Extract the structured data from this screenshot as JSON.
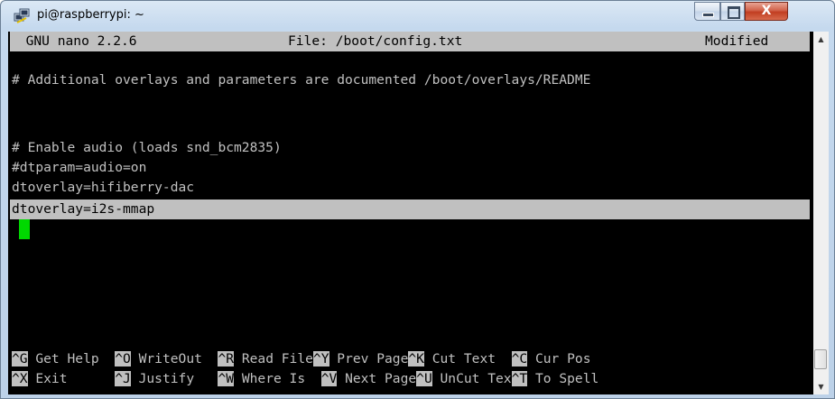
{
  "window": {
    "title": "pi@raspberrypi: ~",
    "icons": {
      "app": "putty-icon",
      "minimize": "minimize-icon",
      "maximize": "maximize-icon",
      "close": "close-icon"
    },
    "close_label": "X"
  },
  "nano": {
    "header": {
      "version": "  GNU nano 2.2.6",
      "file": "File: /boot/config.txt",
      "status": "Modified "
    },
    "lines": [
      "",
      "# Additional overlays and parameters are documented /boot/overlays/README",
      "",
      "# Enable audio (loads snd_bcm2835)",
      "#dtparam=audio=on",
      "dtoverlay=hifiberry-dac",
      "dtoverlay=i2s-mmap"
    ],
    "shortcuts": {
      "row1": [
        {
          "key": "^G",
          "label": " Get Help  "
        },
        {
          "key": "^O",
          "label": " WriteOut  "
        },
        {
          "key": "^R",
          "label": " Read File"
        },
        {
          "key": "^Y",
          "label": " Prev Page"
        },
        {
          "key": "^K",
          "label": " Cut Text  "
        },
        {
          "key": "^C",
          "label": " Cur Pos"
        }
      ],
      "row2": [
        {
          "key": "^X",
          "label": " Exit      "
        },
        {
          "key": "^J",
          "label": " Justify   "
        },
        {
          "key": "^W",
          "label": " Where Is  "
        },
        {
          "key": "^V",
          "label": " Next Page"
        },
        {
          "key": "^U",
          "label": " UnCut Tex"
        },
        {
          "key": "^T",
          "label": " To Spell"
        }
      ]
    }
  },
  "colors": {
    "terminal_bg": "#000000",
    "terminal_fg": "#c0c0c0",
    "highlight": "#c0c0c0",
    "cursor": "#00d800"
  },
  "scrollbar": {
    "up_icon": "arrow-up-icon",
    "down_icon": "arrow-down-icon"
  }
}
